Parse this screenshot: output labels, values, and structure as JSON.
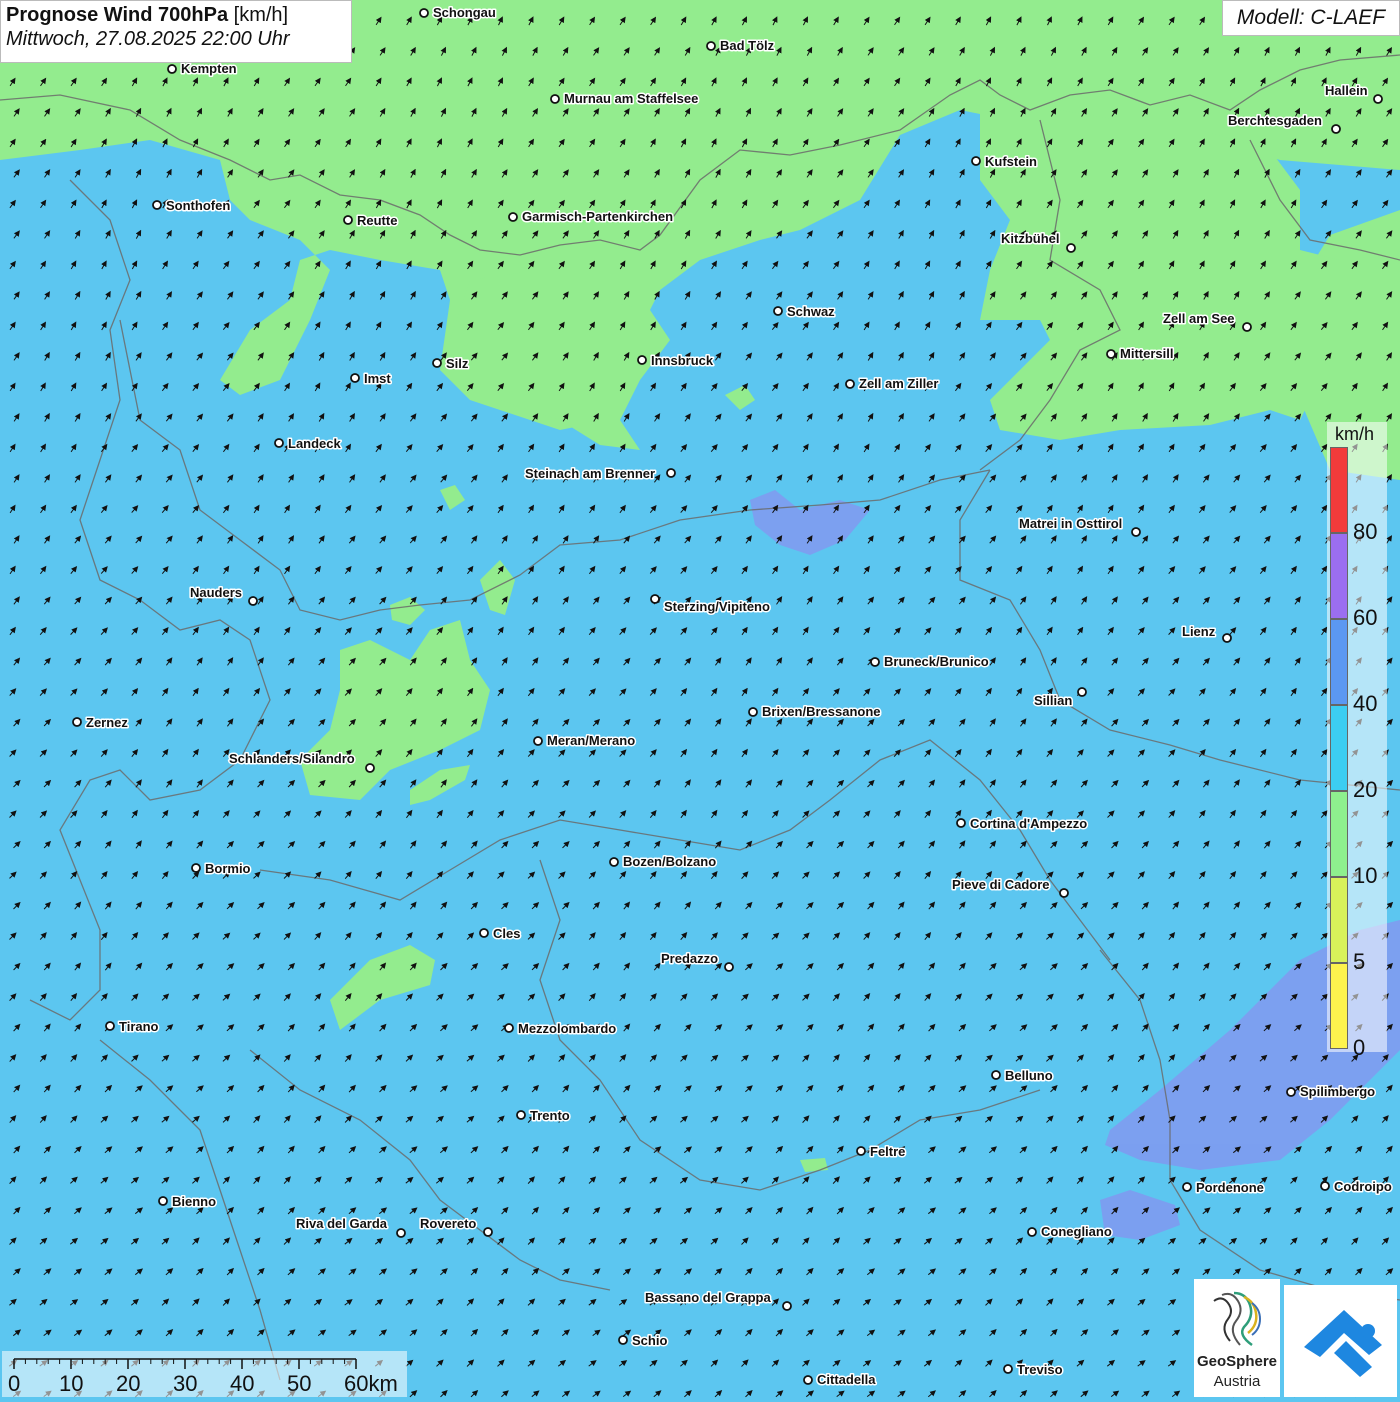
{
  "title": {
    "bold": "Prognose Wind 700hPa",
    "unit": "[km/h]",
    "datetime": "Mittwoch, 27.08.2025 22:00 Uhr"
  },
  "model": "Modell: C-LAEF",
  "legend": {
    "unit": "km/h",
    "classes": [
      {
        "label": "0",
        "color": "#fdf34e"
      },
      {
        "label": "5",
        "color": "#d8f25a"
      },
      {
        "label": "10",
        "color": "#8ef08e"
      },
      {
        "label": "20",
        "color": "#3ccdf2"
      },
      {
        "label": "40",
        "color": "#5b98f2"
      },
      {
        "label": "60",
        "color": "#9b6ef0"
      },
      {
        "label": "80",
        "color": "#f23b3b"
      }
    ]
  },
  "scalebar": {
    "labels": [
      "0",
      "10",
      "20",
      "30",
      "40",
      "50",
      "60km"
    ]
  },
  "map_colors": {
    "base": "#5cc6f0",
    "calm": "#93ec8e",
    "strong": "#7f9bf0",
    "border": "#6b6b6b"
  },
  "wind_direction": "south-west to north-east",
  "cities": [
    "Schongau",
    "Bad Tölz",
    "Kempten",
    "Murnau am Staffelsee",
    "Hallein",
    "Berchtesgaden",
    "Kufstein",
    "Sonthofen",
    "Reutte",
    "Garmisch-Partenkirchen",
    "Kitzbühel",
    "Schwaz",
    "Zell am See",
    "Mittersill",
    "Innsbruck",
    "Imst",
    "Silz",
    "Zell am Ziller",
    "Landeck",
    "Steinach am Brenner",
    "Matrei in Osttirol",
    "Nauders",
    "Sterzing/Vipiteno",
    "Lienz",
    "Bruneck/Brunico",
    "Sillian",
    "Brixen/Bressanone",
    "Zernez",
    "Meran/Merano",
    "Schlanders/Silandro",
    "Cortina d'Ampezzo",
    "Bormio",
    "Bozen/Bolzano",
    "Pieve di Cadore",
    "Cles",
    "Predazzo",
    "Tirano",
    "Mezzolombardo",
    "Belluno",
    "Spilimbergo",
    "Trento",
    "Feltre",
    "Pordenone",
    "Codroipo",
    "Bienno",
    "Riva del Garda",
    "Rovereto",
    "Conegliano",
    "Bassano del Grappa",
    "Schio",
    "Treviso",
    "Cittadella"
  ],
  "logos": {
    "geosphere_name": "GeoSphere",
    "geosphere_sub": "Austria"
  }
}
